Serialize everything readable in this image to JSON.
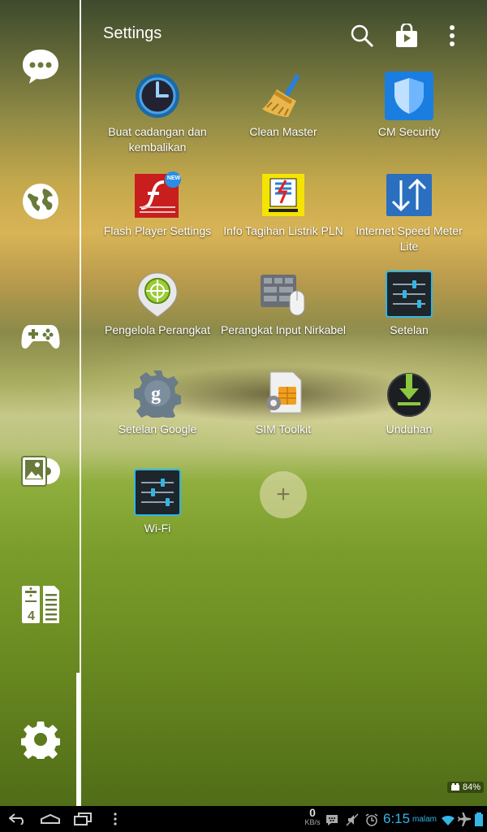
{
  "header": {
    "title": "Settings",
    "search_icon": "search-icon",
    "store_icon": "play-store-icon",
    "menu_icon": "overflow-menu-icon"
  },
  "rail": {
    "items": [
      {
        "icon": "chat-bubble-icon"
      },
      {
        "icon": "globe-icon"
      },
      {
        "icon": "gamepad-icon"
      },
      {
        "icon": "gallery-music-icon"
      },
      {
        "icon": "calculator-notes-icon"
      },
      {
        "icon": "gear-icon"
      }
    ]
  },
  "apps": [
    {
      "label": "Buat cadangan dan kembalikan",
      "icon": "backup-clock-icon"
    },
    {
      "label": "Clean Master",
      "icon": "broom-icon"
    },
    {
      "label": "CM Security",
      "icon": "shield-icon"
    },
    {
      "label": "Flash Player Settings",
      "icon": "flash-player-icon",
      "badge": "NEW"
    },
    {
      "label": "Info Tagihan Listrik PLN",
      "icon": "pln-logo-icon"
    },
    {
      "label": "Internet Speed Meter Lite",
      "icon": "updown-arrows-icon"
    },
    {
      "label": "Pengelola Perangkat",
      "icon": "device-manager-icon"
    },
    {
      "label": "Perangkat Input Nirkabel",
      "icon": "keyboard-mouse-icon"
    },
    {
      "label": "Setelan",
      "icon": "settings-sliders-icon"
    },
    {
      "label": "Setelan Google",
      "icon": "google-settings-icon"
    },
    {
      "label": "SIM Toolkit",
      "icon": "sim-card-icon"
    },
    {
      "label": "Unduhan",
      "icon": "download-icon"
    },
    {
      "label": "Wi-Fi",
      "icon": "wifi-sliders-icon"
    }
  ],
  "add_button": "+",
  "battery_mini": "84%",
  "status_bar": {
    "speed_value": "0",
    "speed_unit": "KB/s",
    "time": "6:15",
    "time_suffix": "malam"
  },
  "colors": {
    "accent": "#33b5e5",
    "flash_red": "#c81e1e",
    "pln_yellow": "#f5e400",
    "cm_blue": "#1a7ee0"
  }
}
